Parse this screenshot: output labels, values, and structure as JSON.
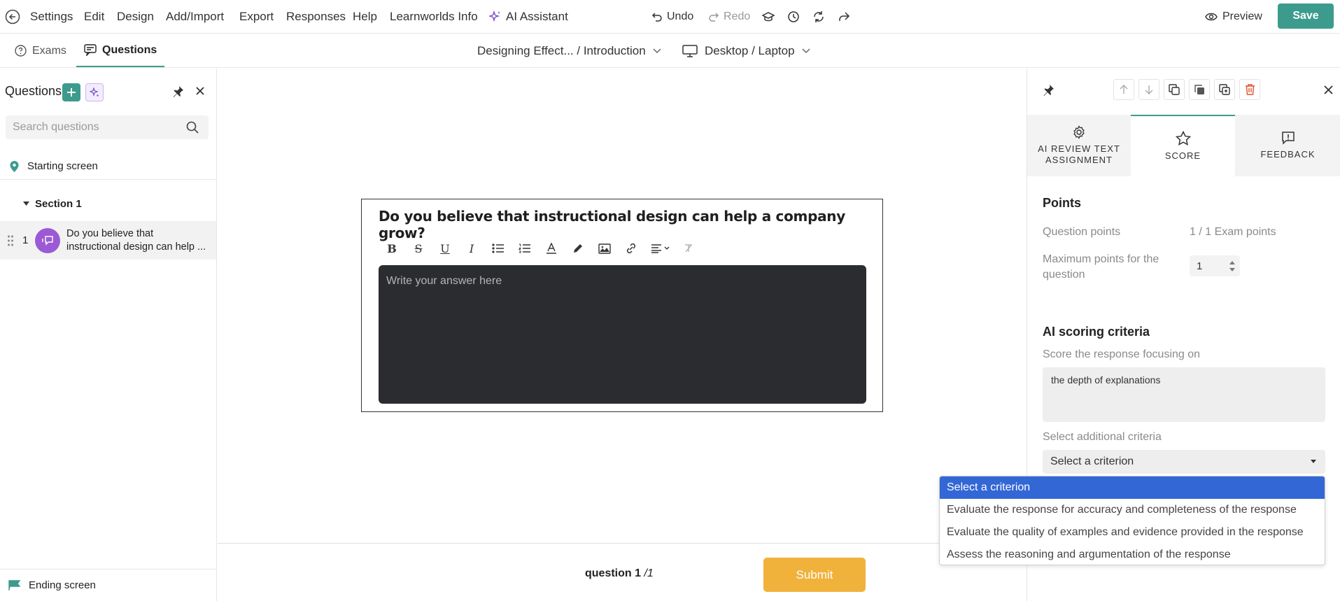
{
  "topbar": {
    "menu": [
      "Settings",
      "Edit",
      "Design",
      "Add/Import",
      "Export",
      "Responses",
      "Help",
      "Learnworlds Info"
    ],
    "ai_assistant": "AI Assistant",
    "undo": "Undo",
    "redo": "Redo",
    "preview": "Preview",
    "save": "Save"
  },
  "secondbar": {
    "tabs": [
      "Exams",
      "Questions"
    ],
    "active_tab": "Questions",
    "breadcrumb": "Designing Effect... / Introduction",
    "device": "Desktop / Laptop"
  },
  "sidebar": {
    "title": "Questions",
    "search_placeholder": "Search questions",
    "starting_screen": "Starting screen",
    "section": "Section 1",
    "question_number": "1",
    "question_line1": "Do you believe that",
    "question_line2": "instructional design can help ...",
    "ending_screen": "Ending screen"
  },
  "canvas": {
    "question_title": "Do you believe that instructional design can help a company grow?",
    "answer_placeholder": "Write your answer here",
    "counter_label": "question",
    "counter_current": "1",
    "counter_total": "/1",
    "submit": "Submit"
  },
  "rpanel": {
    "tabs": [
      {
        "line1": "AI REVIEW TEXT",
        "line2": "ASSIGNMENT"
      },
      {
        "line1": "SCORE",
        "line2": ""
      },
      {
        "line1": "FEEDBACK",
        "line2": ""
      }
    ],
    "active_tab": "SCORE",
    "points_heading": "Points",
    "question_points_label": "Question points",
    "question_points_value": "1 / 1 Exam points",
    "max_points_label_1": "Maximum points for the",
    "max_points_label_2": "question",
    "max_points_value": "1",
    "ai_heading": "AI scoring criteria",
    "focus_label": "Score the response focusing on",
    "focus_value": "the depth of explanations",
    "additional_label": "Select additional criteria",
    "select_value": "Select a criterion"
  },
  "dropdown": {
    "options": [
      "Select a criterion",
      "Evaluate the response for accuracy and completeness of the response",
      "Evaluate the quality of examples and evidence provided in the response",
      "Assess the reasoning and argumentation of the response"
    ],
    "selected_index": 0
  },
  "colors": {
    "accent": "#3c9b8c",
    "ai_purple": "#7c4dcc",
    "submit": "#f0b23b",
    "delete": "#e0502f",
    "selected_option": "#3367d6"
  }
}
